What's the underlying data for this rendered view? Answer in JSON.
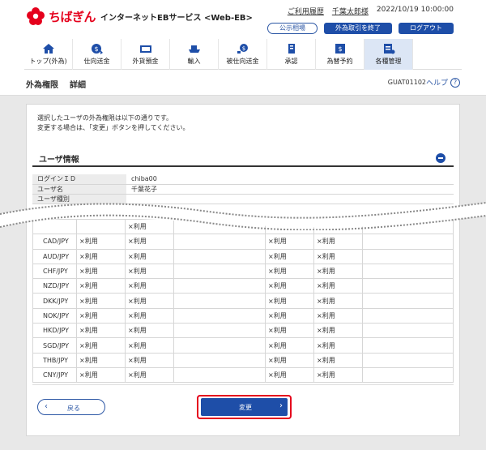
{
  "header": {
    "brand": "ちばぎん",
    "service": "インターネットEBサービス <Web-EB>",
    "usage_history": "ご利用履歴",
    "user_name": "千葉太郎様",
    "datetime": "2022/10/19 10:00:00",
    "public_rates_button": "公示相場",
    "end_fx_button": "外為取引を終了",
    "logout_button": "ログアウト"
  },
  "nav": [
    {
      "label": "トップ(外為)",
      "icon": "home-icon"
    },
    {
      "label": "仕向送金",
      "icon": "outgoing-remittance-icon"
    },
    {
      "label": "外貨預金",
      "icon": "fx-deposit-icon"
    },
    {
      "label": "輸入",
      "icon": "import-ship-icon"
    },
    {
      "label": "被仕向送金",
      "icon": "incoming-remittance-icon"
    },
    {
      "label": "承認",
      "icon": "approval-icon"
    },
    {
      "label": "為替予約",
      "icon": "fx-reservation-icon"
    },
    {
      "label": "各種管理",
      "icon": "management-icon"
    }
  ],
  "page": {
    "title": "外為権限",
    "subtitle": "詳細",
    "code": "GUAT01102",
    "help": "ヘルプ",
    "help_icon": "?"
  },
  "intro_line1": "選択したユーザの外為権限は以下の通りです。",
  "intro_line2": "変更する場合は、「変更」ボタンを押してください。",
  "section_title": "ユーザ情報",
  "user_info": [
    {
      "key": "ログインＩＤ",
      "value": "chiba00"
    },
    {
      "key": "ユーザ名",
      "value": "千葉花子"
    },
    {
      "key": "ユーザ種別",
      "value": ""
    }
  ],
  "perm_partial": {
    "c1": "×利用"
  },
  "perm_rows": [
    {
      "cur": "CAD/JPY",
      "c1": "×利用",
      "c2": "×利用",
      "c3": "",
      "c4": "×利用",
      "c5": "×利用",
      "c6": ""
    },
    {
      "cur": "AUD/JPY",
      "c1": "×利用",
      "c2": "×利用",
      "c3": "",
      "c4": "×利用",
      "c5": "×利用",
      "c6": ""
    },
    {
      "cur": "CHF/JPY",
      "c1": "×利用",
      "c2": "×利用",
      "c3": "",
      "c4": "×利用",
      "c5": "×利用",
      "c6": ""
    },
    {
      "cur": "NZD/JPY",
      "c1": "×利用",
      "c2": "×利用",
      "c3": "",
      "c4": "×利用",
      "c5": "×利用",
      "c6": ""
    },
    {
      "cur": "DKK/JPY",
      "c1": "×利用",
      "c2": "×利用",
      "c3": "",
      "c4": "×利用",
      "c5": "×利用",
      "c6": ""
    },
    {
      "cur": "NOK/JPY",
      "c1": "×利用",
      "c2": "×利用",
      "c3": "",
      "c4": "×利用",
      "c5": "×利用",
      "c6": ""
    },
    {
      "cur": "HKD/JPY",
      "c1": "×利用",
      "c2": "×利用",
      "c3": "",
      "c4": "×利用",
      "c5": "×利用",
      "c6": ""
    },
    {
      "cur": "SGD/JPY",
      "c1": "×利用",
      "c2": "×利用",
      "c3": "",
      "c4": "×利用",
      "c5": "×利用",
      "c6": ""
    },
    {
      "cur": "THB/JPY",
      "c1": "×利用",
      "c2": "×利用",
      "c3": "",
      "c4": "×利用",
      "c5": "×利用",
      "c6": ""
    },
    {
      "cur": "CNY/JPY",
      "c1": "×利用",
      "c2": "×利用",
      "c3": "",
      "c4": "×利用",
      "c5": "×利用",
      "c6": ""
    }
  ],
  "buttons": {
    "back": "戻る",
    "change": "変更",
    "back_arrow": "‹",
    "change_arrow": "›"
  },
  "colors": {
    "brand_red": "#e5001c",
    "primary_blue": "#1e4ea8",
    "active_nav": "#dce6f5"
  }
}
